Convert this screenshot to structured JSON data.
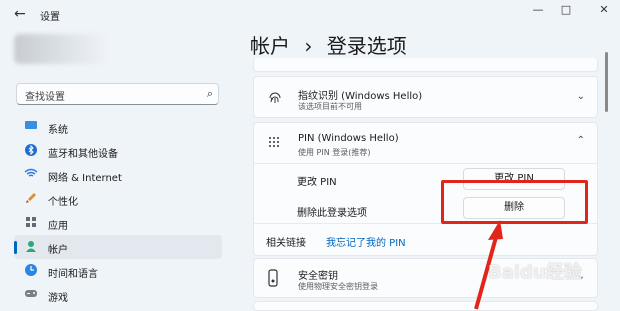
{
  "window": {
    "title": "设置",
    "back_icon": "←",
    "controls": [
      "—",
      "□",
      "✕"
    ]
  },
  "sidebar": {
    "search": {
      "placeholder": "查找设置"
    },
    "items": [
      {
        "label": "系统",
        "icon": "system-icon",
        "color": "#3b8de0"
      },
      {
        "label": "蓝牙和其他设备",
        "icon": "bluetooth-icon",
        "color": "#1f6fd1"
      },
      {
        "label": "网络 & Internet",
        "icon": "wifi-icon",
        "color": "#2d7de0"
      },
      {
        "label": "个性化",
        "icon": "brush-icon",
        "color": "#e48b2c"
      },
      {
        "label": "应用",
        "icon": "apps-icon",
        "color": "#5e6b7a"
      },
      {
        "label": "帐户",
        "icon": "account-icon",
        "color": "#2aa876",
        "active": true
      },
      {
        "label": "时间和语言",
        "icon": "clock-icon",
        "color": "#2a86de"
      },
      {
        "label": "游戏",
        "icon": "game-icon",
        "color": "#7a7f86"
      }
    ]
  },
  "breadcrumb": {
    "parent": "帐户",
    "sep": "›",
    "current": "登录选项"
  },
  "cards": {
    "fingerprint": {
      "title": "指纹识别 (Windows Hello)",
      "subtitle": "该选项目前不可用"
    },
    "pin": {
      "title": "PIN (Windows Hello)",
      "subtitle": "使用 PIN 登录(推荐)",
      "change_label": "更改 PIN",
      "change_button": "更改 PIN",
      "remove_label": "删除此登录选项",
      "remove_button": "删除",
      "related_label": "相关链接",
      "related_link": "我忘记了我的 PIN"
    },
    "security_key": {
      "title": "安全密钥",
      "subtitle": "使用物理安全密钥登录"
    }
  },
  "colors": {
    "accent": "#0067c0",
    "highlight": "#e1251b"
  },
  "watermark": "Baidu经验"
}
